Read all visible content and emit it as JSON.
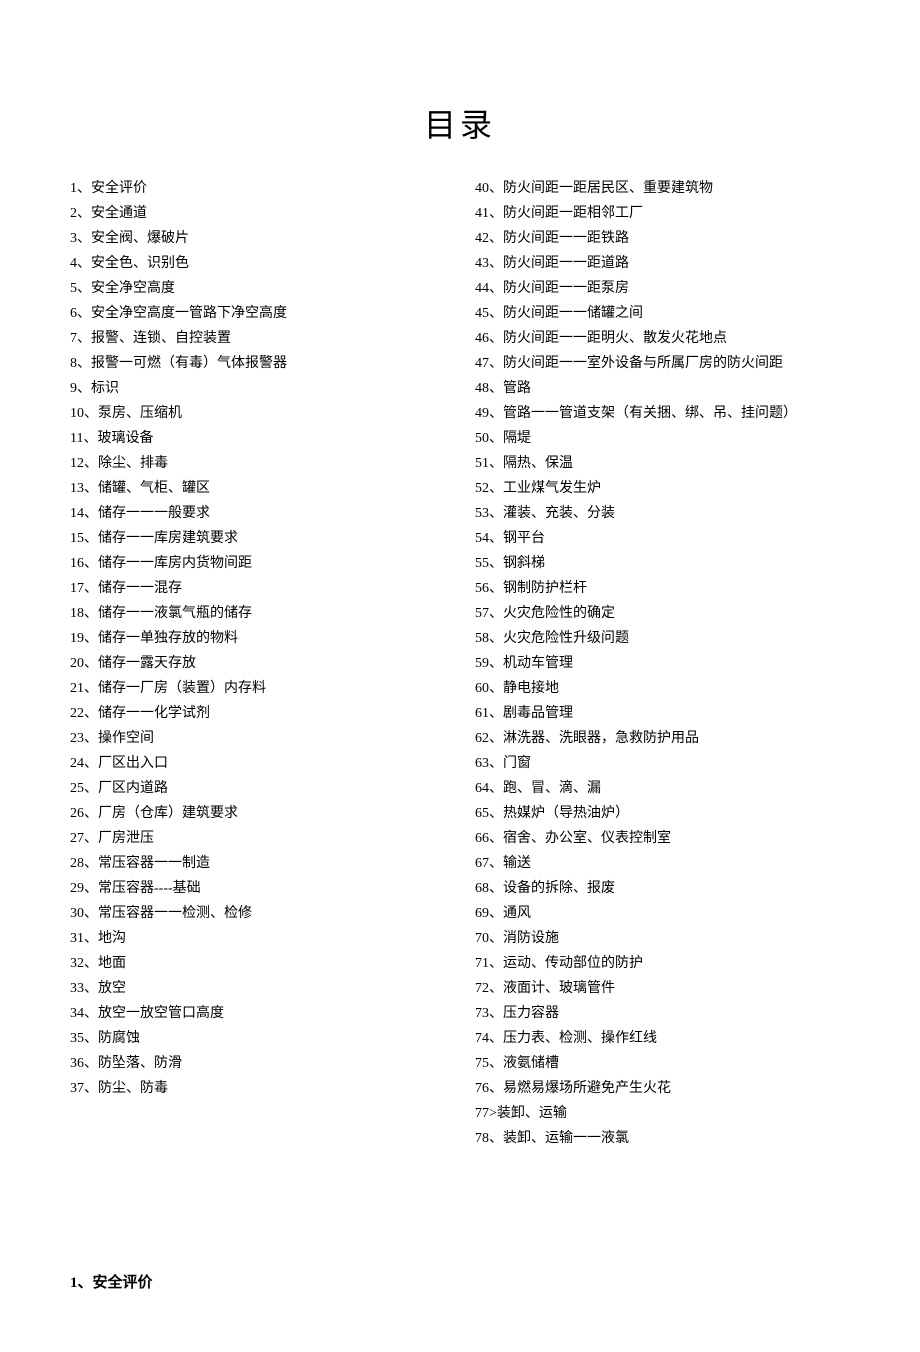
{
  "title": "目录",
  "separator_a": "、",
  "separator_b": "、",
  "section1": {
    "num": "1",
    "label": "安全评价"
  },
  "col1": [
    {
      "num": "1",
      "label": "安全评价"
    },
    {
      "num": "2",
      "label": "安全通道"
    },
    {
      "num": "3",
      "label": "安全阀、爆破片"
    },
    {
      "num": "4",
      "label": "安全色、识别色"
    },
    {
      "num": "5",
      "label": "安全净空高度"
    },
    {
      "num": "6",
      "label": "安全净空高度一管路下净空高度"
    },
    {
      "num": "7",
      "label": "报警、连锁、自控装置"
    },
    {
      "num": "8",
      "label": "报警一可燃（有毒）气体报警器"
    },
    {
      "num": "9",
      "label": "标识"
    },
    {
      "num": "10",
      "label": "泵房、压缩机"
    },
    {
      "num": "11",
      "label": "玻璃设备"
    },
    {
      "num": "12",
      "label": "除尘、排毒"
    },
    {
      "num": "13",
      "label": "储罐、气柜、罐区"
    },
    {
      "num": "14",
      "label": "储存一一一般要求"
    },
    {
      "num": "15",
      "label": "储存一一库房建筑要求"
    },
    {
      "num": "16",
      "label": "储存一一库房内货物间距"
    },
    {
      "num": "17",
      "label": "储存一一混存"
    },
    {
      "num": "18",
      "label": "储存一一液氯气瓶的储存"
    },
    {
      "num": "19",
      "label": "储存一单独存放的物料"
    },
    {
      "num": "20",
      "label": "储存一露天存放"
    },
    {
      "num": "21",
      "label": "储存一厂房（装置）内存料"
    },
    {
      "num": "22",
      "label": "储存一一化学试剂"
    },
    {
      "num": "23",
      "label": "操作空间"
    },
    {
      "num": "24",
      "label": "厂区出入口"
    },
    {
      "num": "25",
      "label": "厂区内道路"
    },
    {
      "num": "26",
      "label": "厂房（仓库）建筑要求"
    },
    {
      "num": "27",
      "label": "厂房泄压"
    },
    {
      "num": "28",
      "label": "常压容器一一制造"
    },
    {
      "num": "29",
      "label": "常压容器----基础"
    },
    {
      "num": "30",
      "label": "常压容器一一检测、检修"
    },
    {
      "num": "31",
      "label": "地沟"
    },
    {
      "num": "32",
      "label": "地面"
    },
    {
      "num": "33",
      "label": "放空"
    },
    {
      "num": "34",
      "label": "放空一放空管口高度"
    },
    {
      "num": "35",
      "label": "防腐蚀"
    },
    {
      "num": "36",
      "label": "防坠落、防滑"
    },
    {
      "num": "37",
      "label": "防尘、防毒"
    }
  ],
  "col2": [
    {
      "num": "40",
      "label": "防火间距一距居民区、重要建筑物"
    },
    {
      "num": "41",
      "label": "防火间距一距相邻工厂"
    },
    {
      "num": "42",
      "label": "防火间距一一距铁路"
    },
    {
      "num": "43",
      "label": "防火间距一一距道路"
    },
    {
      "num": "44",
      "label": "防火间距一一距泵房"
    },
    {
      "num": "45",
      "label": "防火间距一一储罐之间"
    },
    {
      "num": "46",
      "label": "防火间距一一距明火、散发火花地点"
    },
    {
      "num": "47",
      "label": "防火间距一一室外设备与所属厂房的防火间距"
    },
    {
      "num": "48",
      "label": "管路"
    },
    {
      "num": "49",
      "label": "管路一一管道支架（有关捆、绑、吊、挂问题）"
    },
    {
      "num": "50",
      "label": "隔堤"
    },
    {
      "num": "51",
      "label": "隔热、保温"
    },
    {
      "num": "52",
      "label": "工业煤气发生炉"
    },
    {
      "num": "53",
      "label": "灌装、充装、分装"
    },
    {
      "num": "54",
      "label": "钢平台"
    },
    {
      "num": "55",
      "label": "钢斜梯"
    },
    {
      "num": "56",
      "label": "钢制防护栏杆"
    },
    {
      "num": "57",
      "label": "火灾危险性的确定"
    },
    {
      "num": "58",
      "label": "火灾危险性升级问题"
    },
    {
      "num": "59",
      "label": "机动车管理"
    },
    {
      "num": "60",
      "label": "静电接地"
    },
    {
      "num": "61",
      "label": "剧毒品管理"
    },
    {
      "num": "62",
      "label": "淋洗器、洗眼器，急救防护用品"
    },
    {
      "num": "63",
      "label": "门窗"
    },
    {
      "num": "64",
      "label": "跑、冒、滴、漏"
    },
    {
      "num": "65",
      "label": "热媒炉（导热油炉）"
    },
    {
      "num": "66",
      "label": "宿舍、办公室、仪表控制室"
    },
    {
      "num": "67",
      "label": "输送"
    },
    {
      "num": "68",
      "label": "设备的拆除、报废"
    },
    {
      "num": "69",
      "label": "通风"
    },
    {
      "num": "70",
      "label": "消防设施"
    },
    {
      "num": "71",
      "label": "运动、传动部位的防护"
    },
    {
      "num": "72",
      "label": "液面计、玻璃管件"
    },
    {
      "num": "73",
      "label": "压力容器"
    },
    {
      "num": "74",
      "label": "压力表、检测、操作红线"
    },
    {
      "num": "75",
      "label": "液氨储槽"
    },
    {
      "num": "76",
      "label": "易燃易爆场所避免产生火花"
    },
    {
      "num": "77",
      "sep": ">",
      "label": "装卸、运输"
    },
    {
      "num": "78",
      "label": "装卸、运输一一液氯"
    }
  ]
}
